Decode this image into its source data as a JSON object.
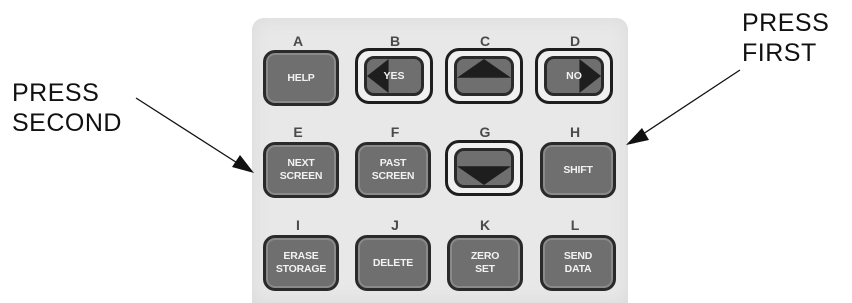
{
  "callouts": {
    "press_second": [
      "PRESS",
      "SECOND"
    ],
    "press_first": [
      "PRESS",
      "FIRST"
    ]
  },
  "keys": {
    "A": {
      "letter": "A",
      "label": "HELP"
    },
    "B": {
      "letter": "B",
      "label": "YES",
      "icon": "left-arrow-icon"
    },
    "C": {
      "letter": "C",
      "label": "",
      "icon": "up-arrow-icon"
    },
    "D": {
      "letter": "D",
      "label": "NO",
      "icon": "right-arrow-icon"
    },
    "E": {
      "letter": "E",
      "label": "NEXT\nSCREEN"
    },
    "F": {
      "letter": "F",
      "label": "PAST\nSCREEN"
    },
    "G": {
      "letter": "G",
      "label": "",
      "icon": "down-arrow-icon"
    },
    "H": {
      "letter": "H",
      "label": "SHIFT"
    },
    "I": {
      "letter": "I",
      "label": "ERASE\nSTORAGE"
    },
    "J": {
      "letter": "J",
      "label": "DELETE"
    },
    "K": {
      "letter": "K",
      "label": "ZERO\nSET"
    },
    "L": {
      "letter": "L",
      "label": "SEND\nDATA"
    }
  },
  "colors": {
    "panel": "#e8e8e8",
    "key": "#6f6f6f",
    "key_border": "#2a2a2a",
    "arrow_icon": "#1e1e1e"
  }
}
